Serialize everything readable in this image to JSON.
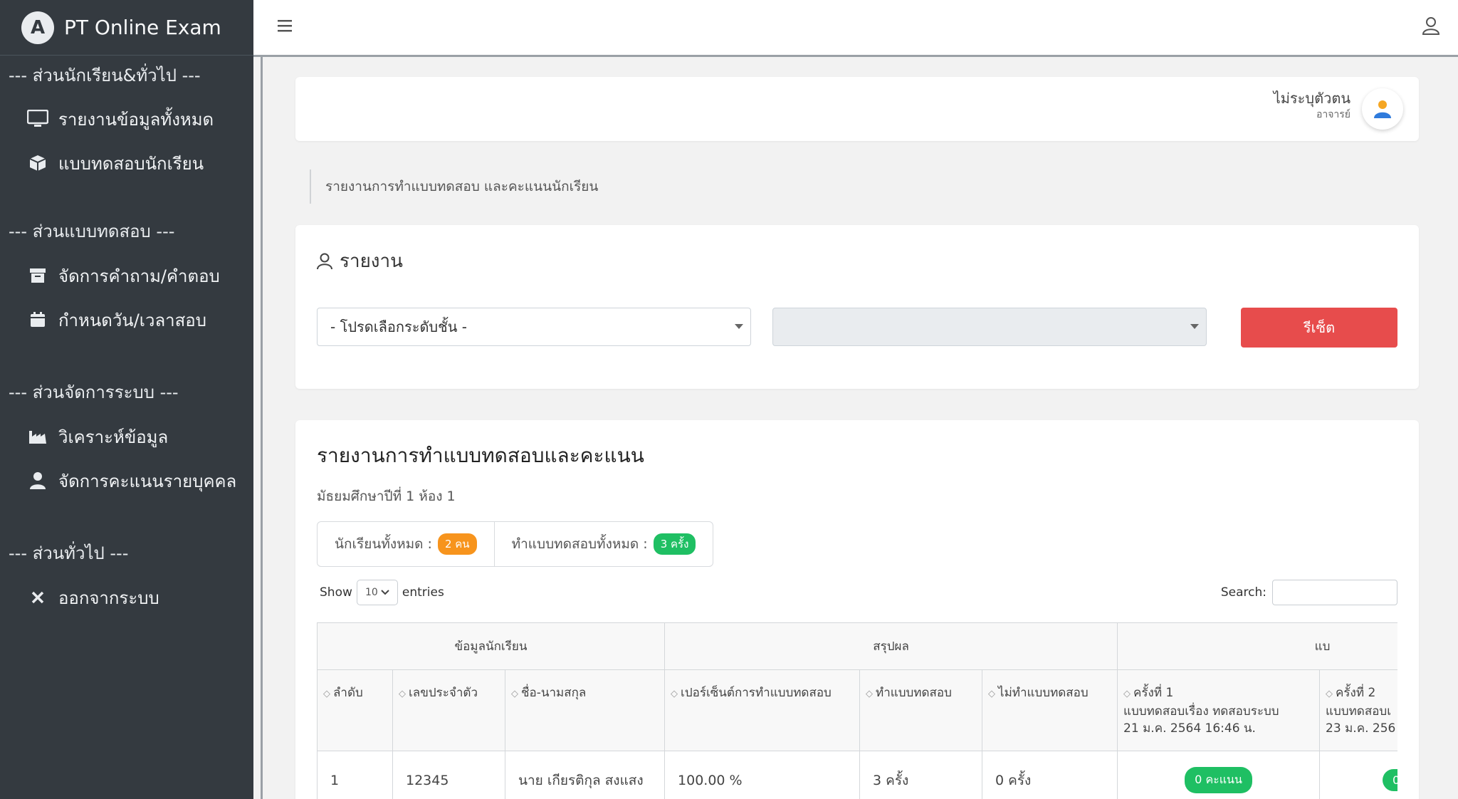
{
  "app": {
    "title": "PT Online Exam"
  },
  "sidebar": {
    "sections": [
      {
        "label": "--- ส่วนนักเรียน&ทั่วไป ---"
      },
      {
        "label": "--- ส่วนแบบทดสอบ ---"
      },
      {
        "label": "--- ส่วนจัดการระบบ ---"
      },
      {
        "label": "--- ส่วนทั่วไป ---"
      }
    ],
    "items": [
      {
        "label": "รายงานข้อมูลทั้งหมด",
        "icon": "monitor-icon"
      },
      {
        "label": "แบบทดสอบนักเรียน",
        "icon": "box-icon"
      },
      {
        "label": "จัดการคำถาม/คำตอบ",
        "icon": "archive-icon"
      },
      {
        "label": "กำหนดวัน/เวลาสอบ",
        "icon": "calendar-icon"
      },
      {
        "label": "วิเคราะห์ข้อมูล",
        "icon": "industry-icon"
      },
      {
        "label": "จัดการคะแนนรายบุคคล",
        "icon": "user-icon"
      },
      {
        "label": "ออกจากระบบ",
        "icon": "close-icon"
      }
    ]
  },
  "profile": {
    "name": "ไม่ระบุตัวตน",
    "role": "อาจารย์"
  },
  "breadcrumb": "รายงานการทำแบบทดสอบ และคะแนนนักเรียน",
  "report": {
    "title": "รายงาน",
    "select_level": "- โปรดเลือกระดับชั้น -",
    "select_room": "",
    "reset_label": "รีเซ็ต"
  },
  "results": {
    "title": "รายงานการทำแบบทดสอบและคะแนน",
    "subtitle": "มัธยมศึกษาปีที่ 1 ห้อง 1",
    "stat_students_label": "นักเรียนทั้งหมด :",
    "stat_students_badge": "2 คน",
    "stat_tests_label": "ทำแบบทดสอบทั้งหมด :",
    "stat_tests_badge": "3 ครั้ง",
    "show_label": "Show",
    "entries_value": "10",
    "entries_label": "entries",
    "search_label": "Search:",
    "groups": [
      "ข้อมูลนักเรียน",
      "สรุปผล",
      "แบ"
    ],
    "columns": [
      "ลำดับ",
      "เลขประจำตัว",
      "ชื่อ-นามสกุล",
      "เปอร์เซ็นต์การทำแบบทดสอบ",
      "ทำแบบทดสอบ",
      "ไม่ทำแบบทดสอบ"
    ],
    "attempt_1": {
      "label": "ครั้งที่ 1",
      "test": "แบบทดสอบเรื่อง ทดสอบระบบ",
      "date": "21 ม.ค. 2564 16:46 น."
    },
    "attempt_2": {
      "label": "ครั้งที่ 2",
      "test": "แบบทดสอบเ",
      "date": "23 ม.ค. 256"
    },
    "rows": [
      {
        "no": "1",
        "id": "12345",
        "name": "นาย เกียรติกุล สงแสง",
        "percent": "100.00 %",
        "done": "3 ครั้ง",
        "not_done": "0 ครั้ง",
        "score1": "0 คะแนน",
        "score2": "0"
      }
    ]
  },
  "colors": {
    "sidebar": "#343a40",
    "reset": "#e74c4c",
    "badge_orange": "#f7941d",
    "badge_green": "#1fbf63"
  }
}
